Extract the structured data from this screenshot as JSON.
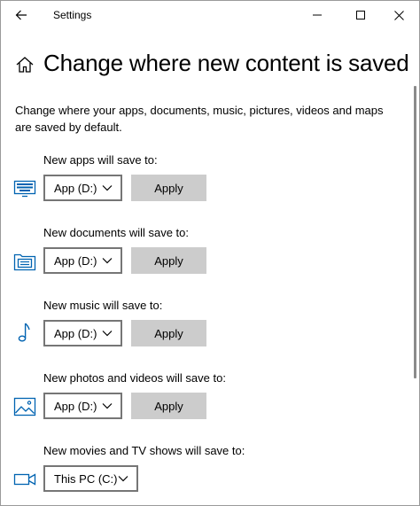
{
  "titlebar": {
    "title": "Settings",
    "back_icon": "arrow-left-icon",
    "minimize_icon": "minimize-icon",
    "maximize_icon": "maximize-icon",
    "close_icon": "close-icon"
  },
  "page": {
    "title": "Change where new content is saved",
    "home_icon": "home-icon",
    "description": "Change where your apps, documents, music, pictures, videos and maps are saved by default."
  },
  "settings": [
    {
      "label": "New apps will save to:",
      "icon": "monitor-keyboard-icon",
      "selected": "App (D:)",
      "apply_label": "Apply"
    },
    {
      "label": "New documents will save to:",
      "icon": "folder-documents-icon",
      "selected": "App (D:)",
      "apply_label": "Apply"
    },
    {
      "label": "New music will save to:",
      "icon": "music-note-icon",
      "selected": "App (D:)",
      "apply_label": "Apply"
    },
    {
      "label": "New photos and videos will save to:",
      "icon": "picture-icon",
      "selected": "App (D:)",
      "apply_label": "Apply"
    },
    {
      "label": "New movies and TV shows will save to:",
      "icon": "video-camera-icon",
      "selected": "This PC (C:)"
    }
  ],
  "colors": {
    "accent": "#0063b1",
    "button_bg": "#cccccc",
    "border": "#767676"
  }
}
